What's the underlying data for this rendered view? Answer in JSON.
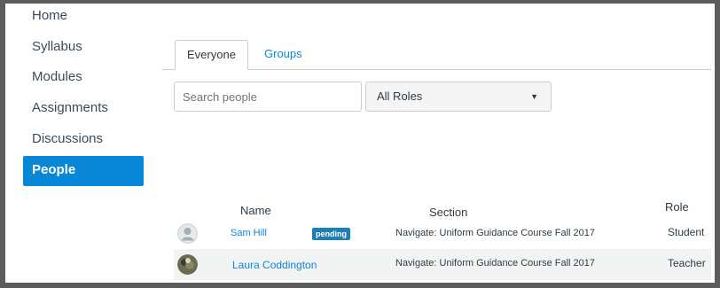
{
  "sidebar": {
    "items": [
      {
        "label": "Home",
        "active": false
      },
      {
        "label": "Syllabus",
        "active": false
      },
      {
        "label": "Modules",
        "active": false
      },
      {
        "label": "Assignments",
        "active": false
      },
      {
        "label": "Discussions",
        "active": false
      },
      {
        "label": "People",
        "active": true
      }
    ]
  },
  "tabs": [
    {
      "label": "Everyone",
      "active": true
    },
    {
      "label": "Groups",
      "active": false
    }
  ],
  "search": {
    "placeholder": "Search people"
  },
  "roles_select": {
    "selected": "All Roles"
  },
  "table": {
    "headers": {
      "name": "Name",
      "section": "Section",
      "role": "Role"
    },
    "rows": [
      {
        "name": "Sam Hill",
        "badge": "pending",
        "section": "Navigate: Uniform Guidance Course Fall 2017",
        "role": "Student",
        "avatar": "default-avatar-icon"
      },
      {
        "name": "Laura Coddington",
        "badge": "",
        "section": "Navigate: Uniform Guidance Course Fall 2017",
        "role": "Teacher",
        "avatar": "photo-avatar"
      }
    ]
  },
  "colors": {
    "accent": "#0a86d6",
    "badge": "#1e7fb2",
    "frame": "#5c5c5c"
  }
}
